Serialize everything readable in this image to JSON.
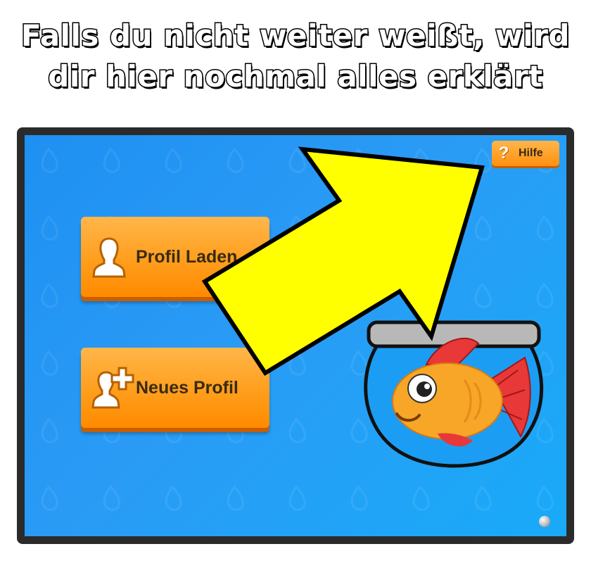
{
  "headline": {
    "line1": "Falls du nicht weiter weißt, wird",
    "line2": "dir hier nochmal alles erklärt"
  },
  "menu": {
    "load_profile_label": "Profil Laden",
    "new_profile_label": "Neues Profil"
  },
  "help": {
    "icon": "?",
    "label": "Hilfe"
  },
  "icons": {
    "load": "person-silhouette-icon",
    "new": "add-person-icon",
    "help": "question-mark-icon",
    "mascot": "goldfish-in-bowl",
    "pointer": "arrow-pointing-up-right"
  },
  "colors": {
    "background_blue": "#1e90f2",
    "button_orange": "#ff9e1c",
    "arrow_yellow": "#ffff00"
  }
}
